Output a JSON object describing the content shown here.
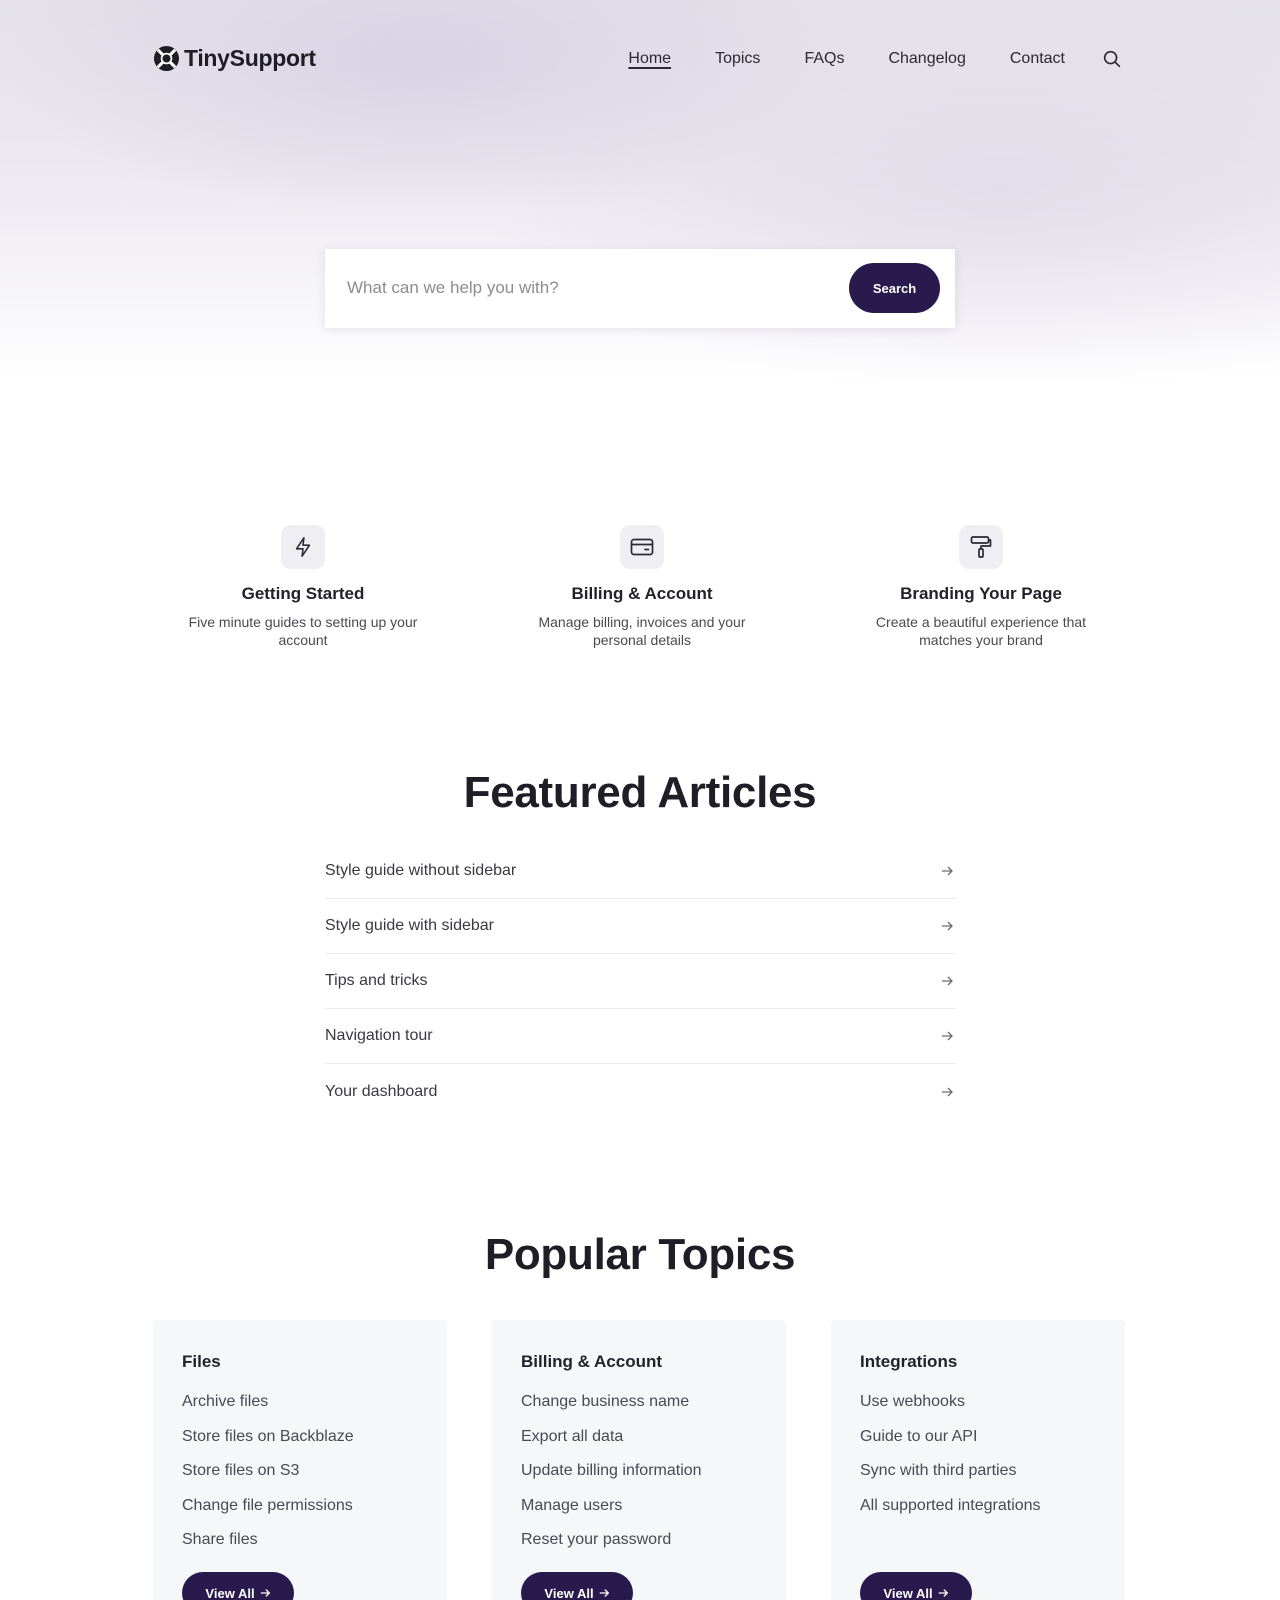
{
  "brand": {
    "name": "TinySupport",
    "accent": "#281a4c"
  },
  "nav": {
    "items": [
      {
        "label": "Home",
        "active": true
      },
      {
        "label": "Topics"
      },
      {
        "label": "FAQs"
      },
      {
        "label": "Changelog"
      },
      {
        "label": "Contact"
      }
    ],
    "search_icon": "search-icon"
  },
  "search": {
    "placeholder": "What can we help you with?",
    "button_label": "Search"
  },
  "features": [
    {
      "icon": "lightning-icon",
      "title": "Getting Started",
      "description": "Five minute guides to setting up your account"
    },
    {
      "icon": "credit-card-icon",
      "title": "Billing & Account",
      "description": "Manage billing, invoices and your personal details"
    },
    {
      "icon": "paint-roller-icon",
      "title": "Branding Your Page",
      "description": "Create a beautiful experience that matches your brand"
    }
  ],
  "featured_articles": {
    "heading": "Featured Articles",
    "items": [
      "Style guide without sidebar",
      "Style guide with sidebar",
      "Tips and tricks",
      "Navigation tour",
      "Your dashboard"
    ]
  },
  "popular_topics": {
    "heading": "Popular Topics",
    "cards": [
      {
        "title": "Files",
        "links": [
          "Archive files",
          "Store files on Backblaze",
          "Store files on S3",
          "Change file permissions",
          "Share files"
        ],
        "button_label": "View All"
      },
      {
        "title": "Billing & Account",
        "links": [
          "Change business name",
          "Export all data",
          "Update billing information",
          "Manage users",
          "Reset your password"
        ],
        "button_label": "View All"
      },
      {
        "title": "Integrations",
        "links": [
          "Use webhooks",
          "Guide to our API",
          "Sync with third parties",
          "All supported integrations"
        ],
        "button_label": "View All"
      }
    ]
  }
}
